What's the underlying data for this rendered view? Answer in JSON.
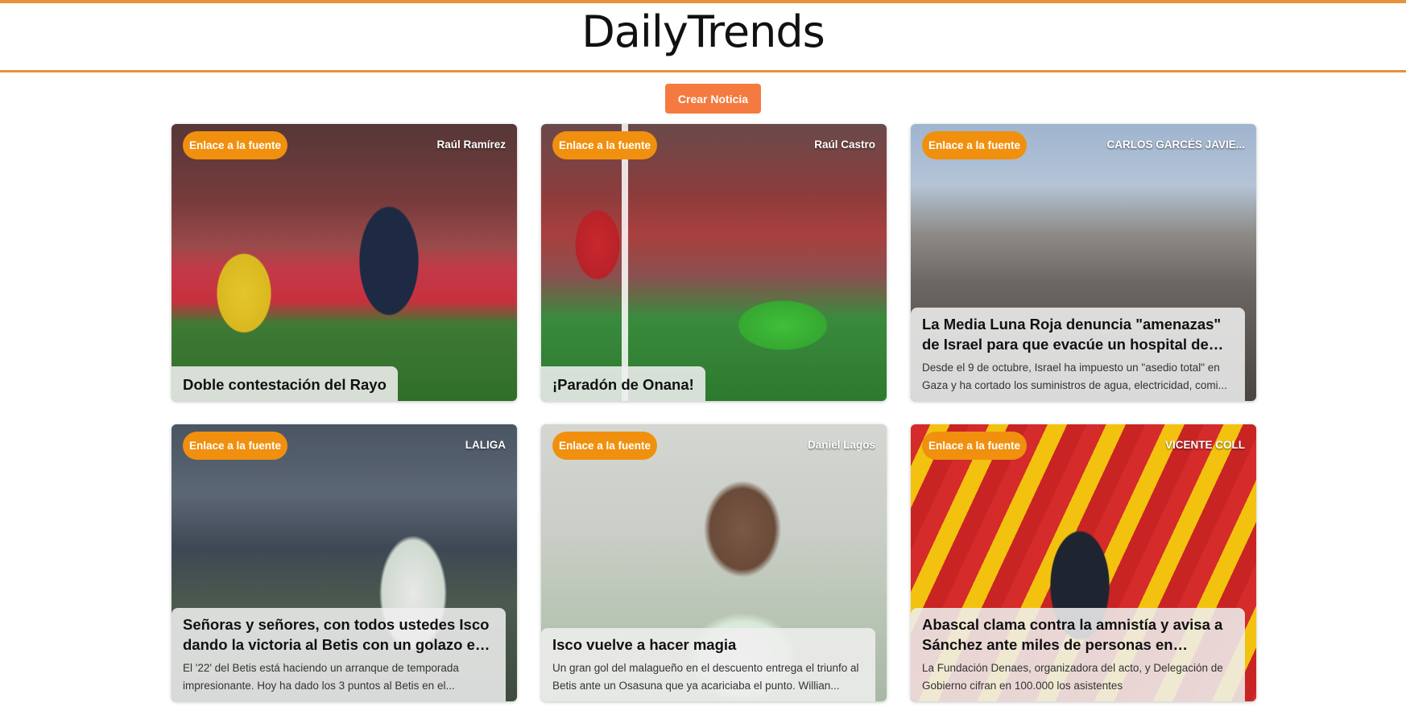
{
  "site": {
    "title": "DailyTrends"
  },
  "actions": {
    "create_label": "Crear Noticia"
  },
  "colors": {
    "accent": "#e8923a",
    "button": "#f47a3f",
    "badge": "#f0900e"
  },
  "cards": [
    {
      "source_label": "Enlace a la fuente",
      "author": "Raúl Ramírez",
      "title": "Doble contestación del Rayo",
      "description": ""
    },
    {
      "source_label": "Enlace a la fuente",
      "author": "Raúl Castro",
      "title": "¡Paradón de Onana!",
      "description": ""
    },
    {
      "source_label": "Enlace a la fuente",
      "author": "CARLOS GARCÉS JAVIE...",
      "title": "La Media Luna Roja denuncia \"amenazas\" de Israel para que evacúe un hospital de Gaza",
      "description": "Desde el 9 de octubre, Israel ha impuesto un \"asedio total\" en Gaza y ha cortado los suministros de agua, electricidad, comi..."
    },
    {
      "source_label": "Enlace a la fuente",
      "author": "LALIGA",
      "title": "Señoras y señores, con todos ustedes Isco dando la victoria al Betis con un golazo en e...",
      "description": "El '22' del Betis está haciendo un arranque de temporada impresionante. Hoy ha dado los 3 puntos al Betis en el..."
    },
    {
      "source_label": "Enlace a la fuente",
      "author": "Daniel Lagos",
      "title": "Isco vuelve a hacer magia",
      "description": "Un gran gol del malagueño en el descuento entrega el triunfo al Betis ante un Osasuna que ya acariciaba el punto. Willian..."
    },
    {
      "source_label": "Enlace a la fuente",
      "author": "VICENTE COLL",
      "title": "Abascal clama contra la amnistía y avisa a Sánchez ante miles de personas en Colón:...",
      "description": "La Fundación Denaes, organizadora del acto, y Delegación de Gobierno cifran en 100.000 los asistentes"
    }
  ]
}
